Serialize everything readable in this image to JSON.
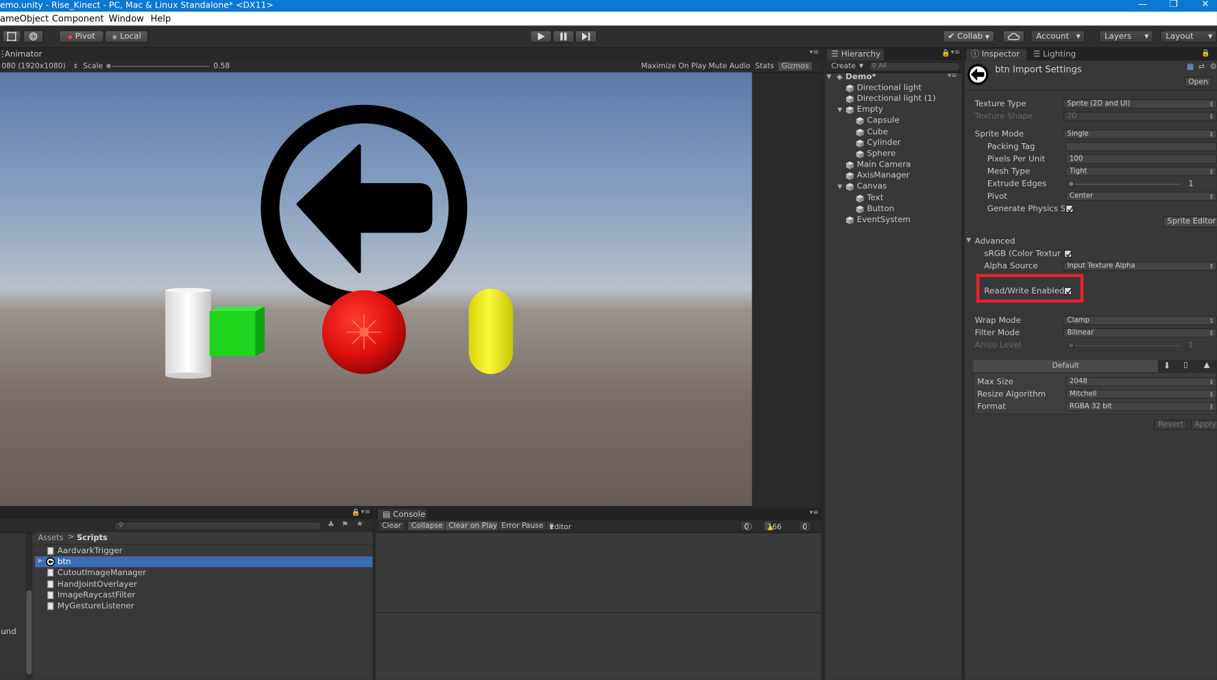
{
  "window": {
    "title": "emo.unity - Rise_Kinect - PC, Mac & Linux Standalone* <DX11>",
    "minimize": "—",
    "restore": "❐",
    "close": "✕"
  },
  "menu": [
    "ameObject",
    "Component",
    "Window",
    "Help"
  ],
  "toolbar": {
    "pivot": "Pivot",
    "local": "Local",
    "collab": "Collab",
    "account": "Account",
    "layers": "Layers",
    "layout": "Layout"
  },
  "game": {
    "tab": "Animator",
    "resolution": "080 (1920x1080)",
    "scale_label": "Scale",
    "scale_value": "0.58",
    "options": [
      "Maximize On Play",
      "Mute Audio",
      "Stats",
      "Gizmos"
    ]
  },
  "hierarchy": {
    "tab": "Hierarchy",
    "create": "Create",
    "search_placeholder": "All",
    "scene": "Demo*",
    "items": [
      {
        "label": "Directional light",
        "level": 1
      },
      {
        "label": "Directional light (1)",
        "level": 1
      },
      {
        "label": "Empty",
        "level": 1,
        "expanded": true
      },
      {
        "label": "Capsule",
        "level": 2
      },
      {
        "label": "Cube",
        "level": 2
      },
      {
        "label": "Cylinder",
        "level": 2
      },
      {
        "label": "Sphere",
        "level": 2
      },
      {
        "label": "Main Camera",
        "level": 1
      },
      {
        "label": "AxisManager",
        "level": 1
      },
      {
        "label": "Canvas",
        "level": 1,
        "expanded": true
      },
      {
        "label": "Text",
        "level": 2
      },
      {
        "label": "Button",
        "level": 2
      },
      {
        "label": "EventSystem",
        "level": 1
      }
    ]
  },
  "inspector": {
    "tab": "Inspector",
    "tab2": "Lighting",
    "title": "btn Import Settings",
    "open": "Open",
    "texture_type_label": "Texture Type",
    "texture_type": "Sprite (2D and UI)",
    "texture_shape_label": "Texture Shape",
    "texture_shape": "2D",
    "sprite_mode_label": "Sprite Mode",
    "sprite_mode": "Single",
    "packing_tag_label": "Packing Tag",
    "packing_tag": "",
    "ppu_label": "Pixels Per Unit",
    "ppu": "100",
    "mesh_type_label": "Mesh Type",
    "mesh_type": "Tight",
    "extrude_label": "Extrude Edges",
    "extrude": "1",
    "pivot_label": "Pivot",
    "pivot": "Center",
    "gen_physics_label": "Generate Physics Sl",
    "sprite_editor": "Sprite Editor",
    "advanced": "Advanced",
    "srgb_label": "sRGB (Color Textur",
    "alpha_source_label": "Alpha Source",
    "alpha_source": "Input Texture Alpha",
    "rw_label": "Read/Write Enabled",
    "wrap_label": "Wrap Mode",
    "wrap": "Clamp",
    "filter_label": "Filter Mode",
    "filter": "Bilinear",
    "aniso_label": "Aniso Level",
    "aniso": "1",
    "platform_default": "Default",
    "max_size_label": "Max Size",
    "max_size": "2048",
    "resize_label": "Resize Algorithm",
    "resize": "Mitchell",
    "format_label": "Format",
    "format": "RGBA 32 bit",
    "revert": "Revert",
    "apply": "Apply",
    "highlight_color": "#e8232a"
  },
  "project": {
    "breadcrumb_root": "Assets",
    "breadcrumb_sep": ">",
    "breadcrumb_folder": "Scripts",
    "left_partial": "und",
    "items": [
      "AardvarkTrigger",
      "btn",
      "CutoutImageManager",
      "HandJointOverlayer",
      "ImageRaycastFilter",
      "MyGestureListener"
    ],
    "selected_index": 1
  },
  "console": {
    "tab": "Console",
    "buttons": [
      "Clear",
      "Collapse",
      "Clear on Play",
      "Error Pause",
      "Editor"
    ],
    "info_count": "0",
    "warn_count": "166",
    "error_count": "0"
  },
  "colors": {
    "accent": "#0b78d3",
    "selection": "#3d6bb3",
    "sky_top": "#5d7fae",
    "ground": "#6a5e57",
    "cylinder": "#eeeeee",
    "cube": "#22d622",
    "sphere": "#ee1111",
    "capsule": "#f1ee10"
  }
}
